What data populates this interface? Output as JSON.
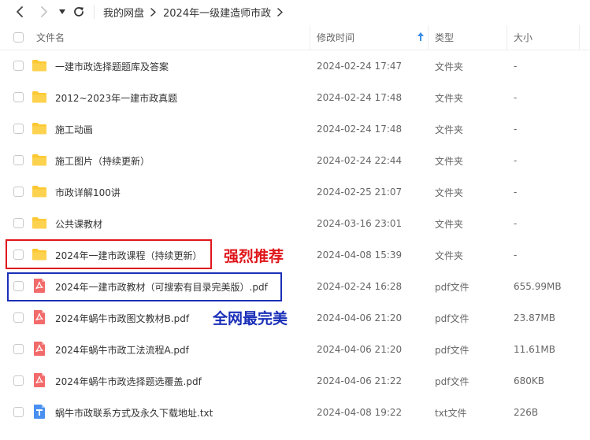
{
  "toolbar": {
    "back_icon": "chevron-left-icon",
    "forward_icon": "chevron-right-icon",
    "dropdown_icon": "caret-down-icon",
    "refresh_icon": "refresh-icon"
  },
  "breadcrumb": [
    {
      "label": "我的网盘"
    },
    {
      "label": "2024年一级建造师市政"
    }
  ],
  "table": {
    "columns": {
      "name": "文件名",
      "time": "修改时间",
      "type": "类型",
      "size": "大小"
    },
    "sort_indicator_color": "#3a8ee6",
    "rows": [
      {
        "name": "一建市政选择题题库及答案",
        "time": "2024-02-24 17:47",
        "type": "文件夹",
        "size": "-",
        "icon": "folder-icon"
      },
      {
        "name": "2012~2023年一建市政真题",
        "time": "2024-02-24 17:48",
        "type": "文件夹",
        "size": "-",
        "icon": "folder-icon"
      },
      {
        "name": "施工动画",
        "time": "2024-02-24 17:48",
        "type": "文件夹",
        "size": "-",
        "icon": "folder-icon"
      },
      {
        "name": "施工图片（持续更新）",
        "time": "2024-02-24 22:44",
        "type": "文件夹",
        "size": "-",
        "icon": "folder-icon"
      },
      {
        "name": "市政详解100讲",
        "time": "2024-02-25 21:07",
        "type": "文件夹",
        "size": "-",
        "icon": "folder-icon"
      },
      {
        "name": "公共课教材",
        "time": "2024-03-16 23:01",
        "type": "文件夹",
        "size": "-",
        "icon": "folder-icon"
      },
      {
        "name": "2024年一建市政课程（持续更新）",
        "time": "2024-04-08 15:39",
        "type": "文件夹",
        "size": "-",
        "icon": "folder-icon"
      },
      {
        "name": "2024年一建市政教材（可搜索有目录完美版）.pdf",
        "time": "2024-02-24 16:28",
        "type": "pdf文件",
        "size": "655.99MB",
        "icon": "pdf-icon"
      },
      {
        "name": "2024年蜗牛市政图文教材B.pdf",
        "time": "2024-04-06 21:20",
        "type": "pdf文件",
        "size": "23.87MB",
        "icon": "pdf-icon"
      },
      {
        "name": "2024年蜗牛市政工法流程A.pdf",
        "time": "2024-04-06 21:20",
        "type": "pdf文件",
        "size": "11.61MB",
        "icon": "pdf-icon"
      },
      {
        "name": "2024年蜗牛市政选择题选覆盖.pdf",
        "time": "2024-04-06 21:22",
        "type": "pdf文件",
        "size": "680KB",
        "icon": "pdf-icon"
      },
      {
        "name": "蜗牛市政联系方式及永久下载地址.txt",
        "time": "2024-04-08 19:22",
        "type": "txt文件",
        "size": "226B",
        "icon": "txt-icon"
      }
    ]
  },
  "annotations": [
    {
      "text": "强烈推荐",
      "color": "#e0161b"
    },
    {
      "text": "全网最完美",
      "color": "#1a2fb8"
    }
  ],
  "colors": {
    "folder": "#fcc934",
    "pdf": "#f26b6b",
    "txt": "#4a90f0",
    "red_box": "#e0161b",
    "blue_box": "#1a2fb8"
  }
}
